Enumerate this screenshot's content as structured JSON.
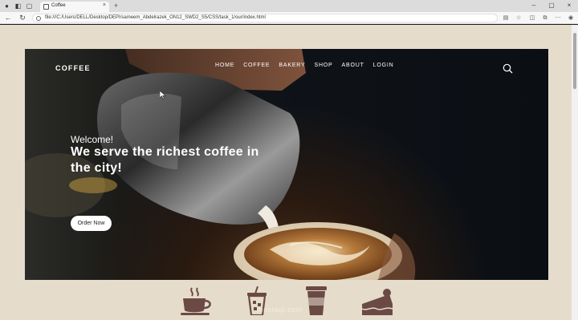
{
  "browser": {
    "tab_title": "Coffee",
    "url": "file:///C:/Users/DELL/Desktop/DEPI/sameem_Abdelrazek_ON12_SWD2_S5/CSS/task_1/our/index.html"
  },
  "site": {
    "logo": "COFFEE",
    "nav": [
      "HOME",
      "COFFEE",
      "BAKERY",
      "SHOP",
      "ABOUT",
      "LOGIN"
    ],
    "welcome": "Welcome!",
    "headline": "We serve the richest coffee in the city!",
    "cta": "Order Now"
  },
  "watermark": "mostaql.com",
  "colors": {
    "page_bg": "#e6dccb",
    "icon_brown": "#6b4a45"
  },
  "icons": [
    "coffee-cup-icon",
    "iced-drink-icon",
    "takeaway-cup-icon",
    "cake-slice-icon"
  ]
}
